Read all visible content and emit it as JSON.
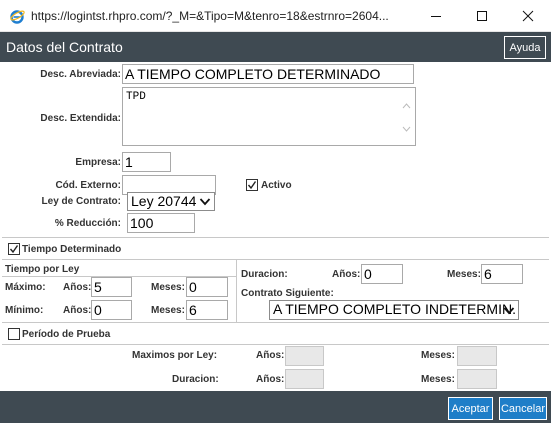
{
  "window": {
    "url": "https://logintst.rhpro.com/?_M=&Tipo=M&tenro=18&estrnro=2604...",
    "icon": "ie-icon"
  },
  "dialog": {
    "title": "Datos del Contrato",
    "help_label": "Ayuda"
  },
  "form": {
    "desc_abreviada_label": "Desc. Abreviada:",
    "desc_abreviada_value": "A TIEMPO COMPLETO DETERMINADO",
    "desc_extendida_label": "Desc. Extendida:",
    "desc_extendida_value": "TPD",
    "empresa_label": "Empresa:",
    "empresa_value": "1",
    "cod_externo_label": "Cód. Externo:",
    "cod_externo_value": "",
    "activo_label": "Activo",
    "activo_checked": true,
    "ley_label": "Ley de Contrato:",
    "ley_value": "Ley 20744",
    "reduccion_label": "% Reducción:",
    "reduccion_value": "100"
  },
  "tiempo_determinado": {
    "label": "Tiempo Determinado",
    "checked": true,
    "tiempo_por_ley_label": "Tiempo por Ley",
    "maximo_label": "Máximo:",
    "minimo_label": "Mínimo:",
    "anios_label": "Años:",
    "meses_label": "Meses:",
    "max_anios": "5",
    "max_meses": "0",
    "min_anios": "0",
    "min_meses": "6",
    "duracion_label": "Duracion:",
    "dur_anios": "0",
    "dur_meses": "6",
    "contrato_siguiente_label": "Contrato Siguiente:",
    "contrato_siguiente_value": "A TIEMPO COMPLETO INDETERMIN."
  },
  "periodo_prueba": {
    "label": "Período de Prueba",
    "checked": false,
    "maximos_label": "Maximos por Ley:",
    "duracion_label": "Duracion:",
    "anios_label": "Años:",
    "meses_label": "Meses:"
  },
  "footer": {
    "accept_label": "Aceptar",
    "cancel_label": "Cancelar"
  },
  "colors": {
    "header_bg": "#3f4a52",
    "button_blue": "#1e7ec8"
  }
}
